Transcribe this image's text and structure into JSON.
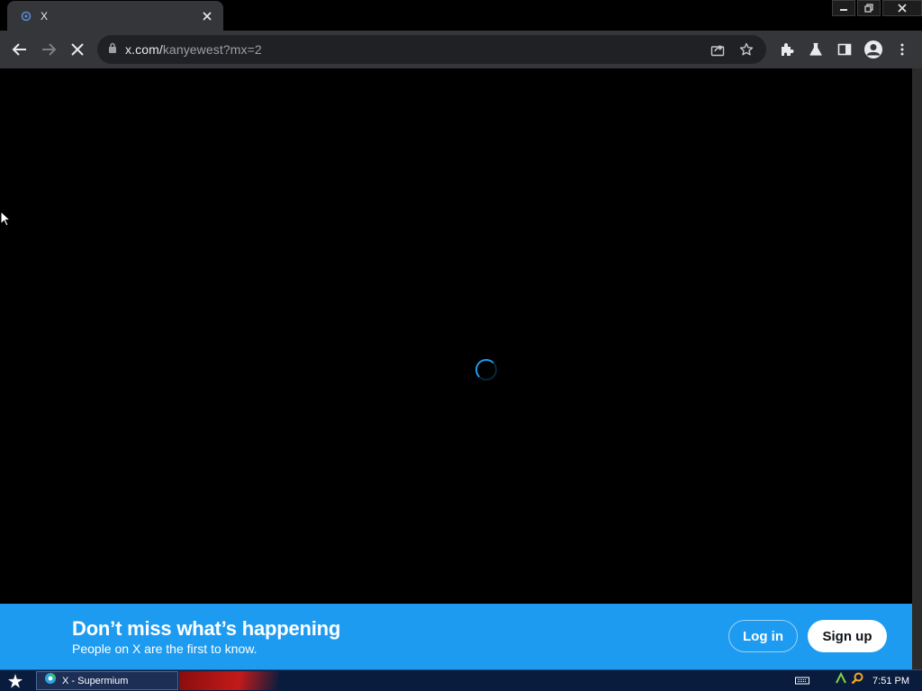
{
  "browser": {
    "tab_title": "X",
    "url_domain": "x.com/",
    "url_path": "kanyewest?mx=2"
  },
  "banner": {
    "heading": "Don’t miss what’s happening",
    "subtext": "People on X are the first to know.",
    "login_label": "Log in",
    "signup_label": "Sign up"
  },
  "taskbar": {
    "task_label": "X - Supermium",
    "clock": "7:51 PM"
  },
  "colors": {
    "brand_blue": "#1d9bf0",
    "toolbar": "#35363a",
    "omnibox": "#202124",
    "taskbar": "#0a1c3e"
  },
  "icons": [
    "x-favicon",
    "tab-close-icon",
    "minimize-icon",
    "restore-icon",
    "window-close-icon",
    "back-arrow-icon",
    "forward-arrow-icon",
    "stop-loading-icon",
    "lock-icon",
    "share-icon",
    "star-icon",
    "extensions-icon",
    "labs-flask-icon",
    "side-panel-icon",
    "profile-icon",
    "kebab-menu-icon",
    "loading-spinner-icon",
    "start-star-icon",
    "supermium-icon",
    "keyboard-icon",
    "network-icon",
    "search-icon"
  ]
}
